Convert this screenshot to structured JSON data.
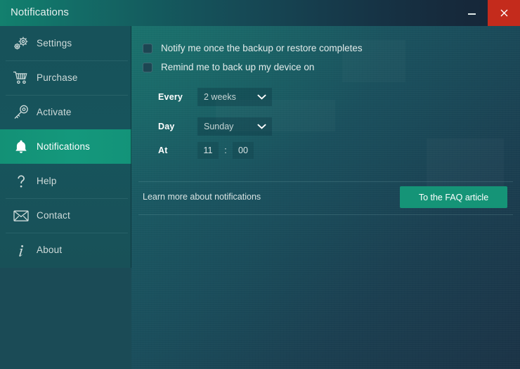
{
  "window": {
    "title": "Notifications",
    "controls": {
      "minimize": "minimize",
      "close": "close"
    },
    "accent_green": "#159477",
    "close_red": "#c42b1c",
    "sidebar_active_bg": "#14987c"
  },
  "sidebar": {
    "items": [
      {
        "label": "Settings",
        "icon": "gears-icon",
        "active": false
      },
      {
        "label": "Purchase",
        "icon": "shopping-cart-icon",
        "active": false
      },
      {
        "label": "Activate",
        "icon": "key-icon",
        "active": false
      },
      {
        "label": "Notifications",
        "icon": "bell-icon",
        "active": true
      },
      {
        "label": "Help",
        "icon": "question-mark-icon",
        "active": false
      },
      {
        "label": "Contact",
        "icon": "envelope-icon",
        "active": false
      },
      {
        "label": "About",
        "icon": "info-icon",
        "active": false
      }
    ]
  },
  "main": {
    "checkboxes": [
      {
        "label": "Notify me once the backup or restore completes",
        "checked": false
      },
      {
        "label": "Remind me to back up my device on",
        "checked": false
      }
    ],
    "schedule": {
      "every_label": "Every",
      "every_value": "2 weeks",
      "day_label": "Day",
      "day_value": "Sunday",
      "at_label": "At",
      "hour_value": "11",
      "time_separator": ":",
      "minute_value": "00"
    },
    "footer": {
      "learn_more_text": "Learn more about notifications",
      "faq_button_label": "To the FAQ article"
    }
  }
}
